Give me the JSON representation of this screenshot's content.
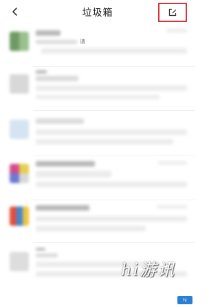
{
  "header": {
    "title": "垃圾箱",
    "back_icon": "chevron-left-icon",
    "edit_icon": "edit-icon",
    "highlight_color": "#d8343d"
  },
  "rows": [
    {
      "snippet": "请",
      "avatar_colors": [
        "#6e9a63",
        "#9ac08e",
        "#c9dcc2",
        "#e3ece0"
      ]
    },
    {
      "snippet": "",
      "avatar_colors": [
        "#cfcfcf",
        "#e0e0e0",
        "#d7d7d7",
        "#ececec"
      ]
    },
    {
      "snippet": "",
      "avatar_colors": [
        "#b8d3ea",
        "#d5e4f2",
        "#e6eef6",
        "#f0f4f8"
      ]
    },
    {
      "snippet": "",
      "avatar_colors": [
        "#d24c8a",
        "#e5cf4e",
        "#6a7bd0",
        "#d8d8d8"
      ]
    },
    {
      "snippet": "",
      "avatar_colors": [
        "#e0503c",
        "#3e86d8",
        "#f0c43c",
        "#4ca364"
      ]
    },
    {
      "snippet": "",
      "avatar_colors": [
        "#cfcfcf",
        "#dddddd",
        "#e6e6e6",
        "#efefef"
      ]
    }
  ],
  "watermark": {
    "text": "hi游讯"
  },
  "corner_logo": {
    "text": "hi"
  }
}
